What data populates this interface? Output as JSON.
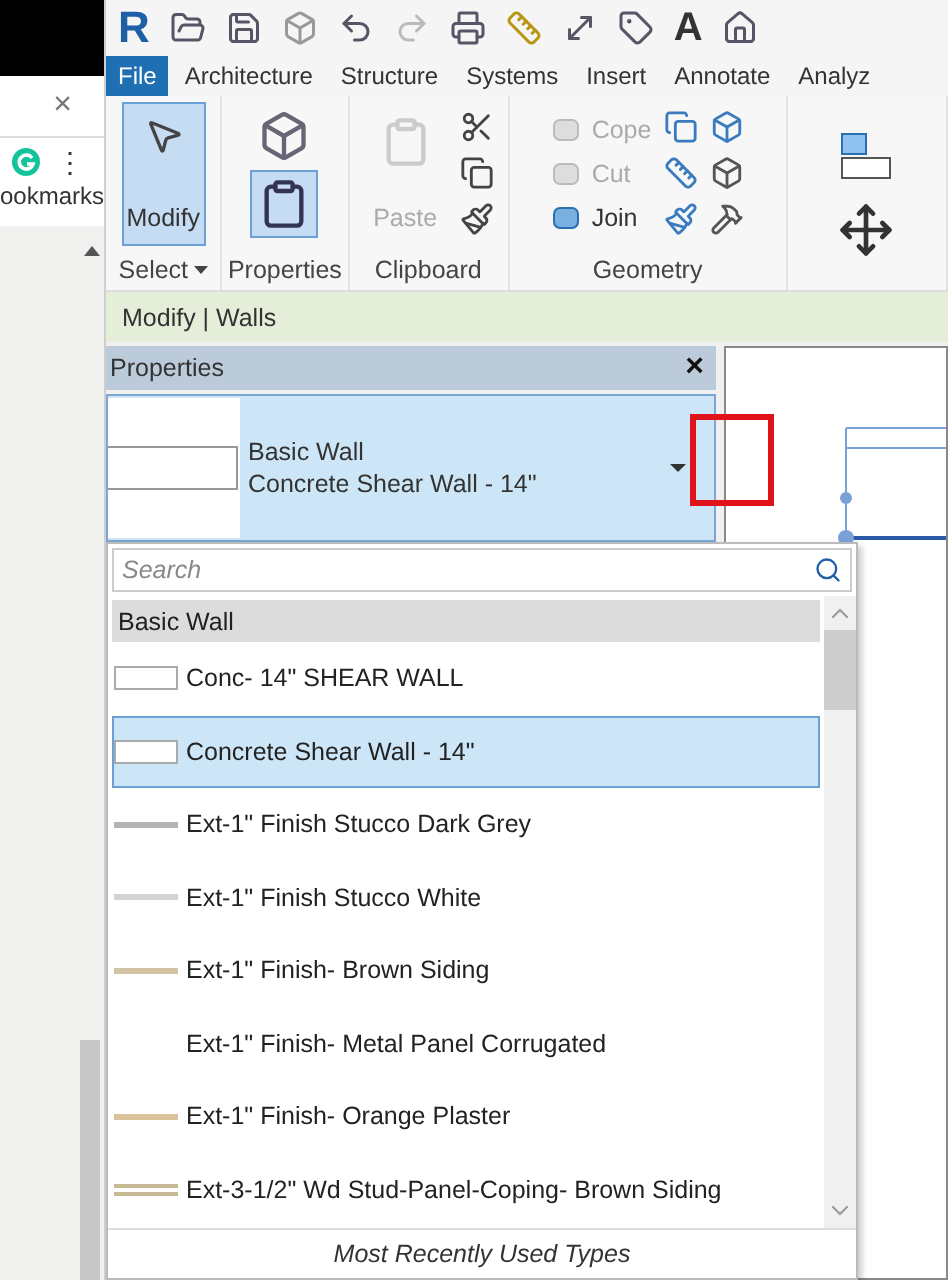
{
  "browser": {
    "close": "×",
    "menu": "⋮",
    "bookmarks": "ookmarks"
  },
  "app": {
    "logo": "R",
    "text_tool": "A"
  },
  "tabs": [
    {
      "label": "File",
      "selected": true
    },
    {
      "label": "Architecture",
      "selected": false
    },
    {
      "label": "Structure",
      "selected": false
    },
    {
      "label": "Systems",
      "selected": false
    },
    {
      "label": "Insert",
      "selected": false
    },
    {
      "label": "Annotate",
      "selected": false
    },
    {
      "label": "Analyz",
      "selected": false
    }
  ],
  "ribbon": {
    "select": {
      "title": "Select",
      "button": {
        "label": "Modify",
        "selected": true
      }
    },
    "properties": {
      "title": "Properties",
      "toggle_selected": true
    },
    "clipboard": {
      "title": "Clipboard",
      "paste": {
        "label": "Paste",
        "disabled": true
      }
    },
    "geometry": {
      "title": "Geometry",
      "tools": [
        {
          "label": "Cope",
          "disabled": true
        },
        {
          "label": "Cut",
          "disabled": true
        },
        {
          "label": "Join",
          "disabled": false
        }
      ]
    }
  },
  "context_bar": "Modify | Walls",
  "properties": {
    "title": "Properties",
    "close": "×",
    "type_family": "Basic Wall",
    "type_name": "Concrete Shear Wall - 14\""
  },
  "type_list": {
    "search": {
      "placeholder": "Search"
    },
    "group": "Basic Wall",
    "items": [
      {
        "label": "Conc- 14\" SHEAR WALL",
        "kind": "box",
        "selected": false
      },
      {
        "label": "Concrete Shear Wall - 14\"",
        "kind": "box",
        "selected": true
      },
      {
        "label": "Ext-1\" Finish Stucco Dark Grey",
        "kind": "line",
        "color": "#b4b4b4",
        "selected": false
      },
      {
        "label": "Ext-1\" Finish Stucco White",
        "kind": "line",
        "color": "#d4d4d4",
        "selected": false
      },
      {
        "label": "Ext-1\" Finish- Brown Siding",
        "kind": "line",
        "color": "#d2c3a4",
        "selected": false
      },
      {
        "label": "Ext-1\" Finish- Metal Panel Corrugated",
        "kind": "none",
        "selected": false
      },
      {
        "label": "Ext-1\" Finish- Orange Plaster",
        "kind": "line",
        "color": "#dcc29a",
        "selected": false
      },
      {
        "label": "Ext-3-1/2\" Wd Stud-Panel-Coping- Brown Siding",
        "kind": "double",
        "color": "#c8b894",
        "selected": false
      }
    ],
    "footer": "Most Recently Used Types"
  }
}
